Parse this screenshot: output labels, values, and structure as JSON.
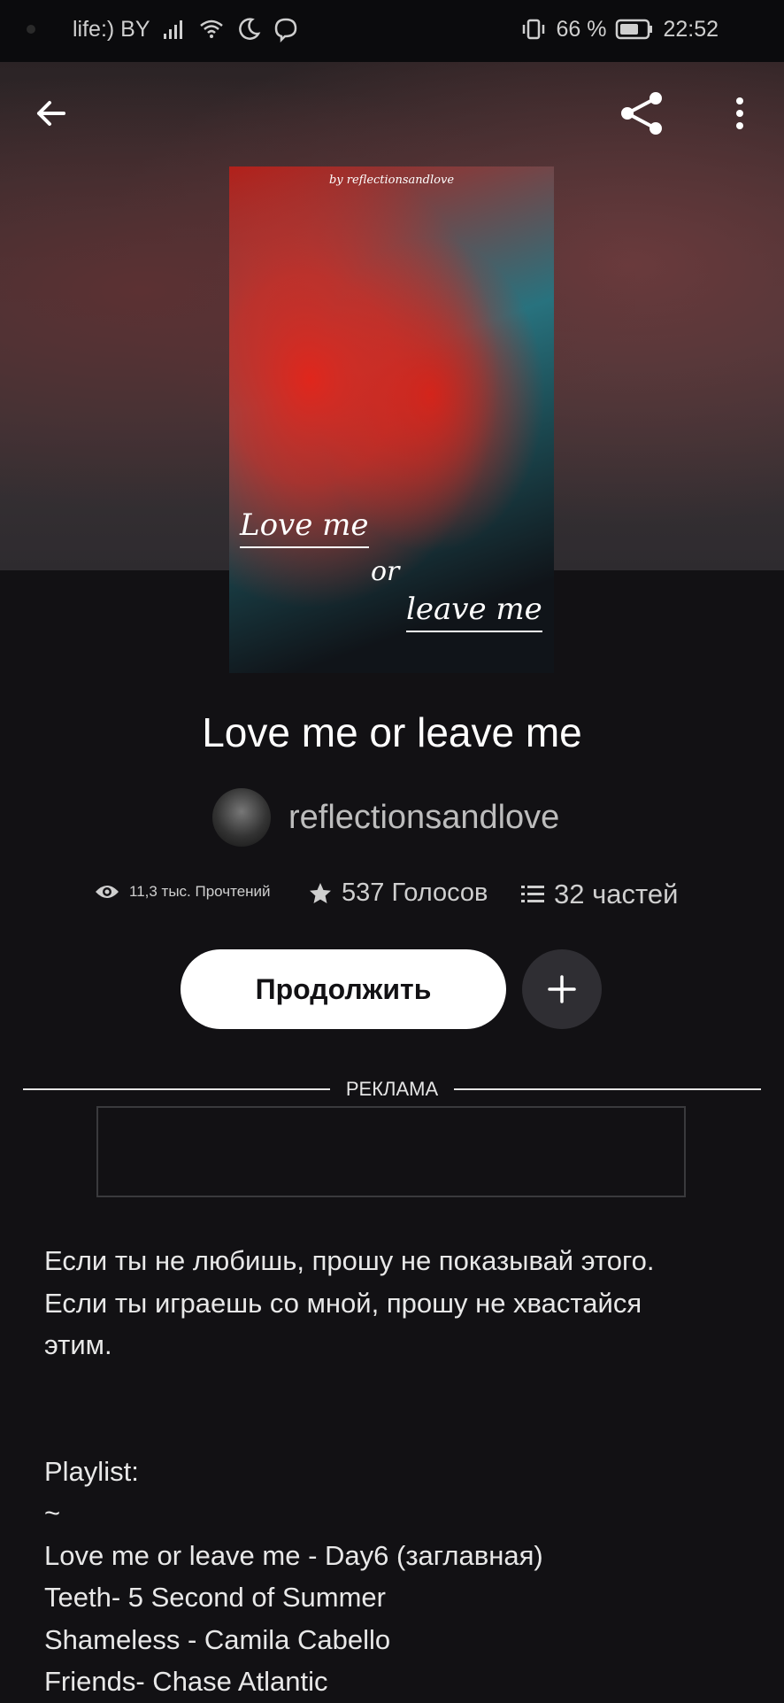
{
  "status_bar": {
    "carrier": "life:) BY",
    "battery": "66 %",
    "time": "22:52"
  },
  "toolbar": {
    "back_icon": "back-arrow-icon",
    "share_icon": "share-icon",
    "more_icon": "more-vertical-icon"
  },
  "cover": {
    "byline": "by reflectionsandlove",
    "line1": "Love me",
    "line2": "or",
    "line3": "leave me"
  },
  "book": {
    "title": "Love me or leave me",
    "author": "reflectionsandlove"
  },
  "stats": {
    "reads": "11,3 тыс. Прочтений",
    "votes": "537 Голосов",
    "parts": "32 частей"
  },
  "actions": {
    "continue_label": "Продолжить"
  },
  "ad": {
    "label": "РЕКЛАМА"
  },
  "description": {
    "text": "Если ты не любишь, прошу не показывай этого.\nЕсли ты играешь со мной, прошу не хвастайся\nэтим.\n\n\nPlaylist:\n~\nLove me or leave me - Day6 (заглавная)\nTeeth- 5 Second of Summer\nShameless - Camila Cabello\nFriends- Chase Atlantic"
  },
  "colors": {
    "background": "#121114",
    "button_bg": "#ffffff",
    "add_button_bg": "#2f2e33"
  }
}
